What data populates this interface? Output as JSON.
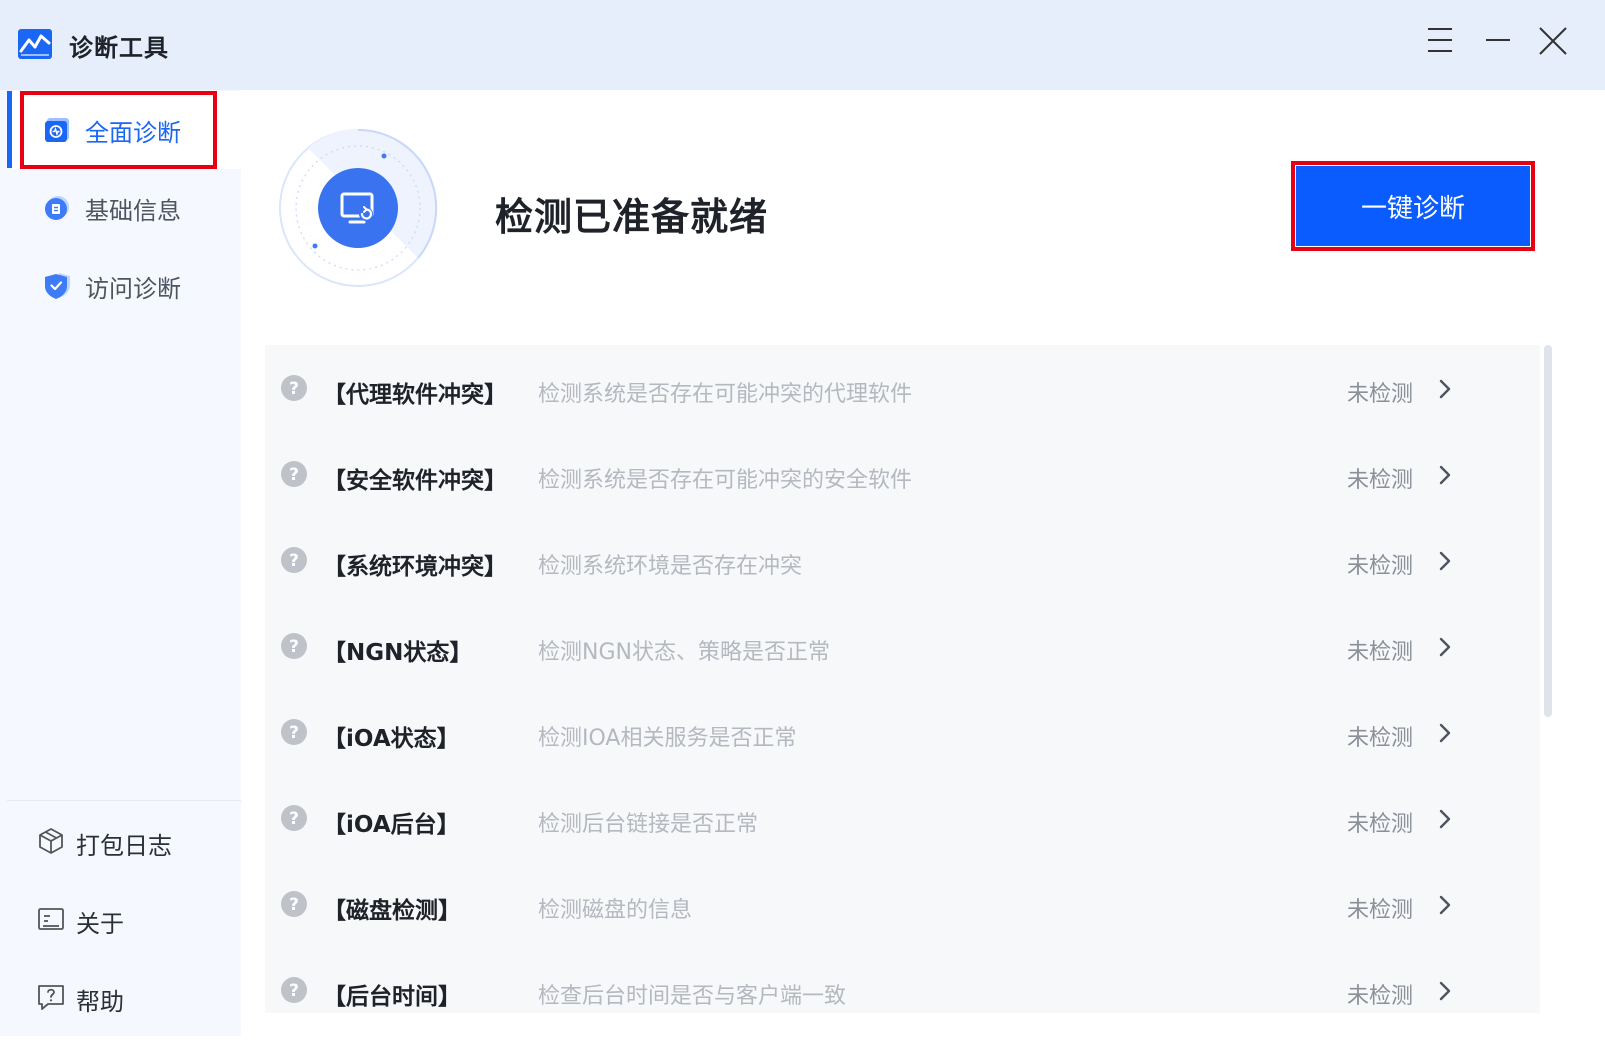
{
  "app": {
    "title": "诊断工具",
    "logo_icon": "chart-line-logo-icon",
    "accent_color": "#1a66f5",
    "highlight_color": "#e60012"
  },
  "window_controls": {
    "menu_icon": "hamburger-menu-icon",
    "minimize_icon": "minimize-icon",
    "close_icon": "close-icon"
  },
  "sidebar": {
    "items": [
      {
        "label": "全面诊断",
        "icon": "full-diagnosis-icon",
        "active": true
      },
      {
        "label": "基础信息",
        "icon": "basic-info-icon",
        "active": false
      },
      {
        "label": "访问诊断",
        "icon": "access-diagnosis-shield-icon",
        "active": false
      }
    ],
    "bottom_items": [
      {
        "label": "打包日志",
        "icon": "package-box-icon"
      },
      {
        "label": "关于",
        "icon": "about-info-icon"
      },
      {
        "label": "帮助",
        "icon": "help-chat-icon"
      }
    ]
  },
  "main": {
    "hero_title": "检测已准备就绪",
    "hero_icon": "monitor-refresh-icon",
    "primary_button": "一键诊断",
    "checks": [
      {
        "name": "【代理软件冲突】",
        "desc": "检测系统是否存在可能冲突的代理软件",
        "status": "未检测"
      },
      {
        "name": "【安全软件冲突】",
        "desc": "检测系统是否存在可能冲突的安全软件",
        "status": "未检测"
      },
      {
        "name": "【系统环境冲突】",
        "desc": "检测系统环境是否存在冲突",
        "status": "未检测"
      },
      {
        "name": "【NGN状态】",
        "desc": "检测NGN状态、策略是否正常",
        "status": "未检测"
      },
      {
        "name": "【iOA状态】",
        "desc": "检测IOA相关服务是否正常",
        "status": "未检测"
      },
      {
        "name": "【iOA后台】",
        "desc": "检测后台链接是否正常",
        "status": "未检测"
      },
      {
        "name": "【磁盘检测】",
        "desc": "检测磁盘的信息",
        "status": "未检测"
      },
      {
        "name": "【后台时间】",
        "desc": "检查后台时间是否与客户端一致",
        "status": "未检测"
      }
    ]
  }
}
